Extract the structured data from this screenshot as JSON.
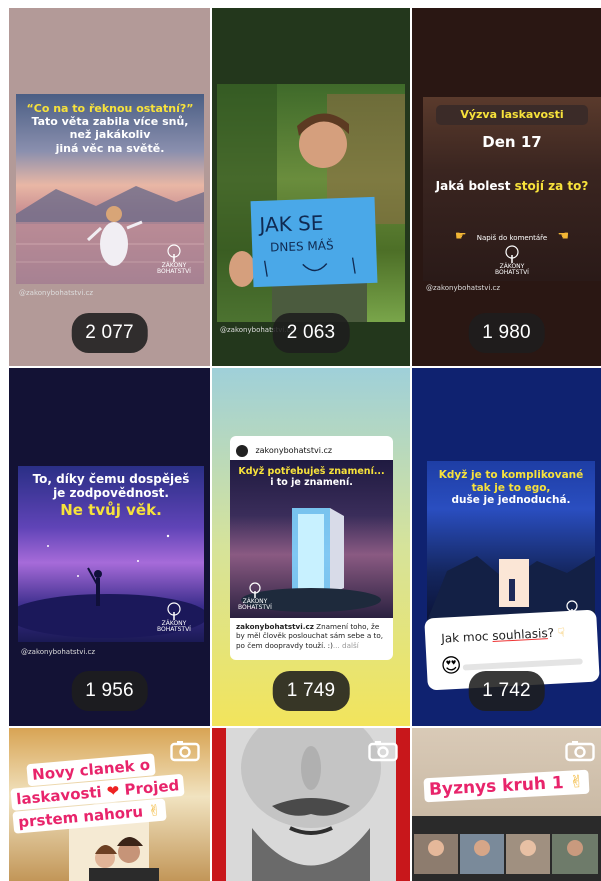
{
  "handle": "@zakonybohatstvi.cz",
  "logo_text": "ZÁKONY BOHATSTVÍ",
  "tiles": [
    {
      "views": "2 077",
      "line1": "“Co na to řeknou ostatní?”",
      "line2": "Tato věta zabila více snů,",
      "line3": "než jakákoliv",
      "line4": "jiná věc na světě."
    },
    {
      "views": "2 063",
      "sign1": "JAK SE",
      "sign2": "DNES MÁŠ"
    },
    {
      "views": "1 980",
      "badge": "Výzva laskavosti",
      "day": "Den 17",
      "q_a": "Jaká bolest ",
      "q_b": "stojí za to?",
      "cta": "Napiš do komentáře"
    },
    {
      "views": "1 956",
      "line1": "To, díky čemu dospěješ",
      "line2": "je zodpovědnost.",
      "line3": "Ne tvůj věk."
    },
    {
      "views": "1 749",
      "account": "zakonybohatstvi.cz",
      "line1": "Když potřebuješ znamení...",
      "line2": "i to je znamení.",
      "cap_user": "zakonybohatstvi.cz",
      "caption": " Znamení toho, že by měl člověk poslouchat sám sebe a to, po čem doopravdy touží. :)",
      "more": "... další"
    },
    {
      "views": "1 742",
      "line1a": "Když je to ",
      "line1b": "komplikované",
      "line2a": "tak je to ",
      "line2b": "ego,",
      "line3": "duše je jednoduchá.",
      "poll_a": "Jak moc ",
      "poll_b": "souhlasis",
      "poll_c": "?",
      "emoji": "😍"
    },
    {
      "sticker1": "Novy clanek o",
      "sticker2a": "laskavosti ",
      "sticker2b": "Projed",
      "sticker3": "prstem nahoru",
      "emoji_heart": "❤",
      "emoji_hand": "✌"
    },
    {},
    {
      "sticker": "Byznys kruh 1",
      "emoji_hand": "✌"
    }
  ]
}
